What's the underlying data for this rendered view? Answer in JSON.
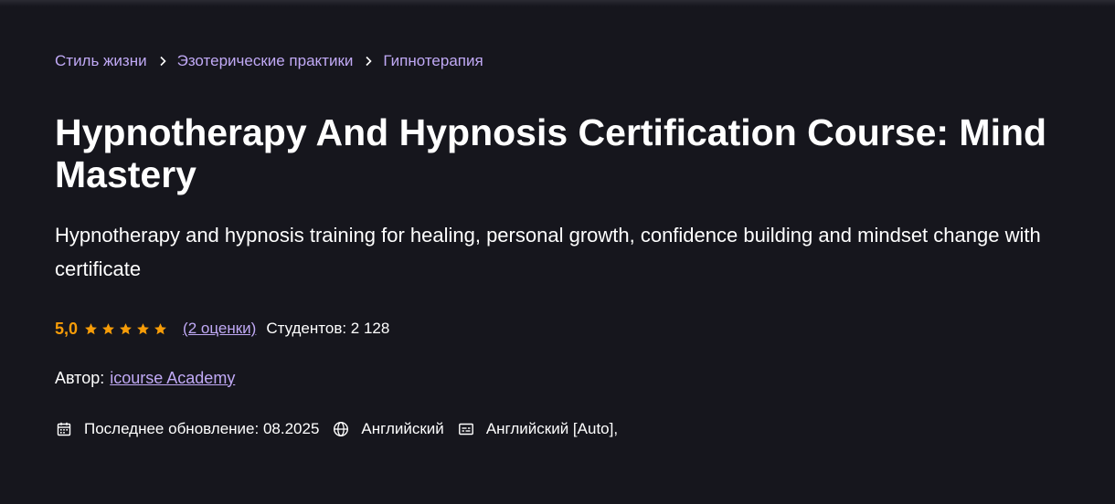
{
  "breadcrumb": {
    "items": [
      "Стиль жизни",
      "Эзотерические практики",
      "Гипнотерапия"
    ]
  },
  "course": {
    "title": "Hypnotherapy And Hypnosis Certification Course: Mind Mastery",
    "subtitle": "Hypnotherapy and hypnosis training for healing, personal growth, confidence building and mindset change with certificate"
  },
  "rating": {
    "value": "5,0",
    "stars": 5,
    "reviews_label": "(2 оценки)",
    "students_label": "Студентов: 2 128"
  },
  "author": {
    "label": "Автор:",
    "name": "icourse Academy"
  },
  "meta": {
    "updated_label": "Последнее обновление: 08.2025",
    "language": "Английский",
    "captions": "Английский [Auto],"
  },
  "icons": {
    "breadcrumb_separator": "chevron-right-icon",
    "star": "star-icon",
    "updated": "calendar-icon",
    "language": "globe-icon",
    "captions": "captions-icon"
  },
  "colors": {
    "background": "#16161d",
    "link": "#c0a9f5",
    "rating": "#f69c08",
    "text": "#ffffff"
  }
}
